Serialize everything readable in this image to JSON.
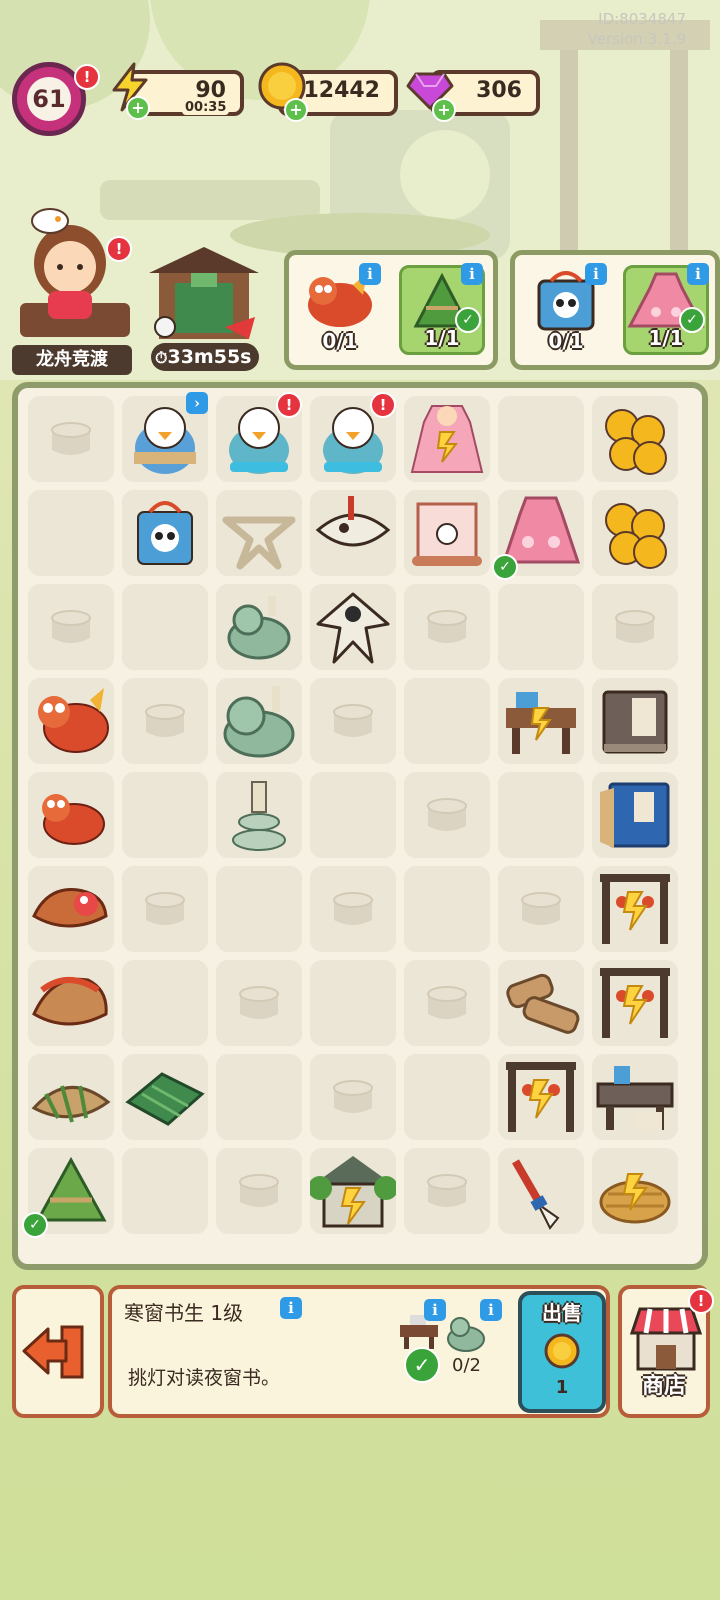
{
  "meta": {
    "id_text": "ID:8034847",
    "version_text": "Version:3.1.9"
  },
  "player": {
    "level": "61"
  },
  "resources": {
    "energy": {
      "value": "90",
      "timer": "00:35"
    },
    "coins": {
      "value": "112442"
    },
    "gems": {
      "value": "306"
    }
  },
  "event": {
    "name": "龙舟竞渡",
    "shop_timer": "33m55s"
  },
  "orders": [
    {
      "items": [
        {
          "icon": "dragon-figure",
          "count": "0/1",
          "done": false
        },
        {
          "icon": "zongzi",
          "count": "1/1",
          "done": true
        }
      ]
    },
    {
      "items": [
        {
          "icon": "panda-bag",
          "count": "0/1",
          "done": false
        },
        {
          "icon": "pink-dress",
          "count": "1/1",
          "done": true
        }
      ]
    }
  ],
  "selected": {
    "title": "寒窗书生 1级",
    "description": "挑灯对读夜窗书。",
    "requirements": [
      {
        "icon": "study-desk",
        "done": true
      },
      {
        "icon": "jade-lion",
        "count": "0/2"
      }
    ],
    "sell_label": "出售",
    "sell_price": "1"
  },
  "buttons": {
    "shop_label": "商店"
  },
  "board_items": [
    {
      "name": "scholar-penguin-scroll",
      "r": 0,
      "c": 1
    },
    {
      "name": "scholar-penguin-reading",
      "r": 0,
      "c": 2
    },
    {
      "name": "scholar-penguin-reading",
      "r": 0,
      "c": 3
    },
    {
      "name": "locked-pink-dress",
      "r": 0,
      "c": 4
    },
    {
      "name": "coin-stack",
      "r": 0,
      "c": 6
    },
    {
      "name": "panda-bag",
      "r": 1,
      "c": 1
    },
    {
      "name": "fish-kite-frame",
      "r": 1,
      "c": 2
    },
    {
      "name": "fish-kite-sketch",
      "r": 1,
      "c": 3
    },
    {
      "name": "painting-scroll",
      "r": 1,
      "c": 4
    },
    {
      "name": "pink-dress",
      "r": 1,
      "c": 5
    },
    {
      "name": "coin-stack",
      "r": 1,
      "c": 6
    },
    {
      "name": "jade-lion-small",
      "r": 2,
      "c": 2
    },
    {
      "name": "swallow-kite",
      "r": 2,
      "c": 3
    },
    {
      "name": "dragon-figure",
      "r": 3,
      "c": 0
    },
    {
      "name": "jade-lion",
      "r": 3,
      "c": 2
    },
    {
      "name": "locked-study-desk",
      "r": 3,
      "c": 5
    },
    {
      "name": "spring-autumn-book",
      "r": 3,
      "c": 6
    },
    {
      "name": "dragon-figure-small",
      "r": 4,
      "c": 0
    },
    {
      "name": "jade-candle",
      "r": 4,
      "c": 2
    },
    {
      "name": "poetry-book",
      "r": 4,
      "c": 6
    },
    {
      "name": "dragon-boat-head",
      "r": 5,
      "c": 0
    },
    {
      "name": "locked-lantern-rack",
      "r": 5,
      "c": 6
    },
    {
      "name": "dragon-boat-woven",
      "r": 6,
      "c": 0
    },
    {
      "name": "bamboo-slips",
      "r": 6,
      "c": 5
    },
    {
      "name": "locked-lantern-rack",
      "r": 6,
      "c": 6
    },
    {
      "name": "reed-bundle",
      "r": 7,
      "c": 0
    },
    {
      "name": "bamboo-leaves",
      "r": 7,
      "c": 1
    },
    {
      "name": "locked-lantern-rack",
      "r": 7,
      "c": 5
    },
    {
      "name": "study-desk",
      "r": 7,
      "c": 6
    },
    {
      "name": "zongzi",
      "r": 8,
      "c": 0
    },
    {
      "name": "locked-pavilion",
      "r": 8,
      "c": 3
    },
    {
      "name": "calligraphy-brush",
      "r": 8,
      "c": 5
    },
    {
      "name": "locked-hay-bundle",
      "r": 8,
      "c": 6
    }
  ]
}
